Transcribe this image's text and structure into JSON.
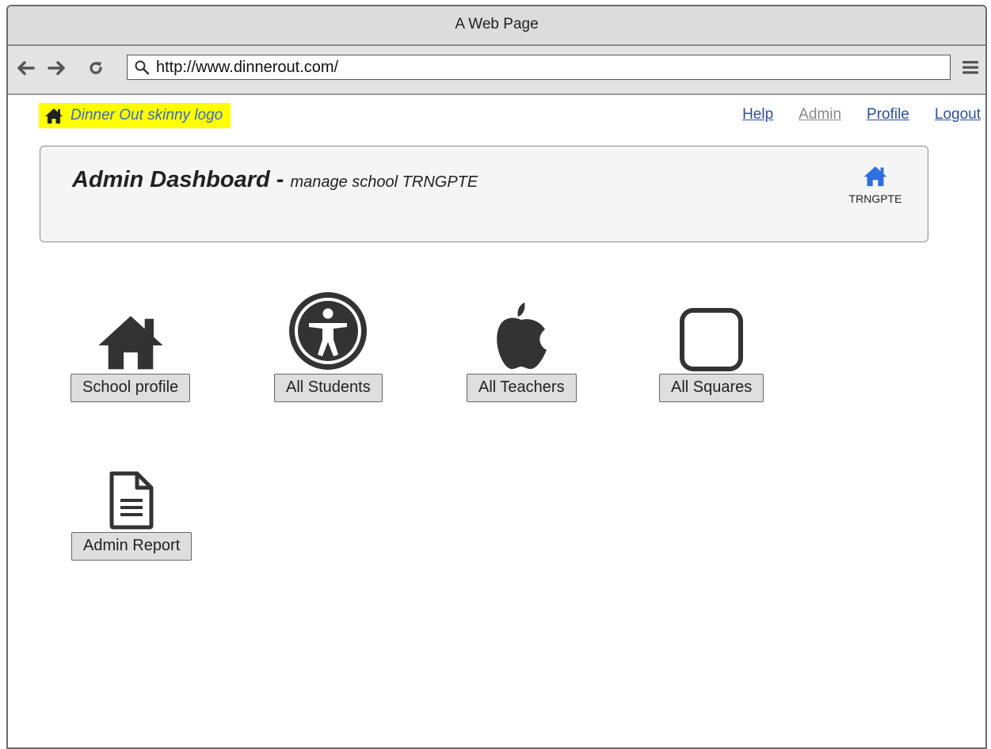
{
  "window": {
    "title": "A Web Page"
  },
  "browser": {
    "url": "http://www.dinnerout.com/",
    "back_icon": "arrow-left-icon",
    "forward_icon": "arrow-right-icon",
    "reload_icon": "reload-icon",
    "menu_icon": "hamburger-menu-icon"
  },
  "header": {
    "logo_text": "Dinner Out skinny logo",
    "links": [
      {
        "label": "Help"
      },
      {
        "label": "Admin"
      },
      {
        "label": "Profile"
      },
      {
        "label": "Logout"
      }
    ]
  },
  "dashboard": {
    "title": "Admin Dashboard -",
    "subtitle": "manage school TRNGPTE",
    "school_code": "TRNGPTE",
    "accent_color": "#2f6fe0"
  },
  "tiles": [
    {
      "label": "School profile",
      "icon": "home-icon"
    },
    {
      "label": "All Students",
      "icon": "accessibility-icon"
    },
    {
      "label": "All Teachers",
      "icon": "apple-icon"
    },
    {
      "label": "All Squares",
      "icon": "square-icon"
    },
    {
      "label": "Admin Report",
      "icon": "document-icon"
    }
  ]
}
